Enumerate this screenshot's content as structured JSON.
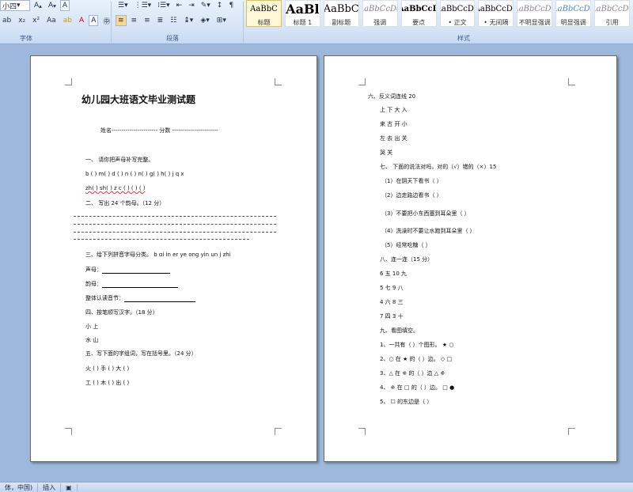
{
  "ribbon": {
    "font_size": "小四",
    "font_group_label": "字体",
    "paragraph_group_label": "段落",
    "styles_group_label": "样式",
    "styles": [
      {
        "sample": "AaBbC",
        "name": "标题"
      },
      {
        "sample": "AaBl",
        "name": "标题 1"
      },
      {
        "sample": "AaBbC",
        "name": "副标题"
      },
      {
        "sample": "AaBbCcDd",
        "name": "强调"
      },
      {
        "sample": "AaBbCcD",
        "name": "要点"
      },
      {
        "sample": "AaBbCcDd",
        "name": "• 正文"
      },
      {
        "sample": "AaBbCcDd",
        "name": "• 无间隔"
      },
      {
        "sample": "AaBbCcDd",
        "name": "不明显强调"
      },
      {
        "sample": "AaBbCcDd",
        "name": "明显强调"
      },
      {
        "sample": "AaBbCcDd",
        "name": "引用"
      }
    ]
  },
  "page1": {
    "title": "幼儿园大班语文毕业测试题",
    "name_line": "姓名-----------------------  分数 -----------------------",
    "lines": [
      "一、 请你把声母补写完整。",
      "b ( ) m( ) d ( ) n ( ) n( ) g( ) h( ) j q x",
      "zh( ) sh( ) z c ( ) ( ) ( )",
      "二、 写出 24 个韵母。（12 分）",
      "三、给下列拼音字母分类。  b ɑi in er ye ong yin un j zhi",
      "声母：",
      "韵母：",
      "整体认读音节：",
      "四、按笔顺写汉字。（18 分）",
      "小 上",
      "水 山",
      "五、写下面的字组词，写在括号里。（24 分）",
      "火 (   )   手 (   )   大 (   )",
      "工 (   )   木 (   )   出 (   )"
    ]
  },
  "page2": {
    "lines": [
      "六、反义词连线 20",
      "上 下 大 入",
      "来 古 开 小",
      "左 去 出 关",
      "哭 关",
      "七、 下面的说法对吗，对的（√）错的（×）15",
      "（1）在阴天下看书（ ）",
      "（2）边走路边看书（ ）",
      "（3）不要把小东西塞到耳朵里（ ）",
      "（4）洗澡时不要让水跑到耳朵里（ ）",
      "（5）经常吃糖（ ）",
      "八、连一连（15 分）",
      "6 五 10 九",
      "5 七 9 八",
      "4 六 8 三",
      "7 四 3 十",
      "九、看图填空。",
      "1、一共有（ ）个图形。 ★ ○",
      "2、○ 在 ★ 的（ ）边。 ◇ □",
      "3、△ 在 ※ 的（ ）边 △ ※",
      "4、 ※ 在 □ 的（ ）边。 □ ●",
      "5、 ☐ 的东边是（ ）"
    ]
  },
  "statusbar": {
    "language": "体，中国)",
    "mode": "插入"
  }
}
